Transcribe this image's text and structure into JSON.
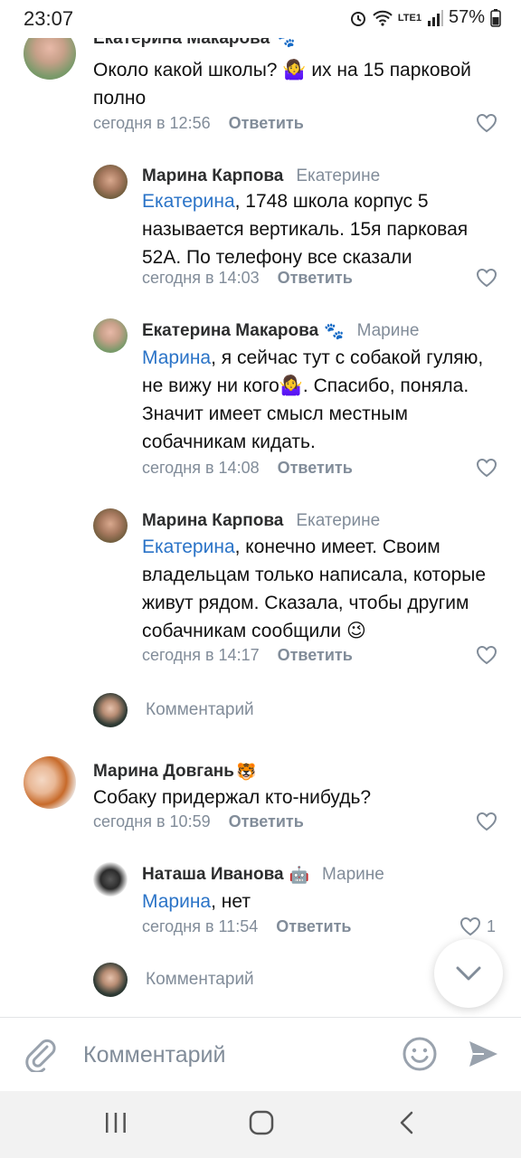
{
  "status_bar": {
    "time": "23:07",
    "battery": "57%",
    "network": "LTE1"
  },
  "comments": [
    {
      "author": "Екатерина Макарова",
      "emoji": "🐾",
      "text_parts": [
        "Около какой школы? ",
        "🤷‍♀️",
        " их на 15 парковой полно"
      ],
      "time": "сегодня в 12:56",
      "reply": "Ответить"
    },
    {
      "author": "Марина Карпова",
      "reply_to": "Екатерине",
      "mention": "Екатерина",
      "text": ", 1748 школа корпус 5 называется вертикаль. 15я парковая 52А. По телефону все сказали",
      "time": "сегодня в 14:03",
      "reply": "Ответить"
    },
    {
      "author": "Екатерина Макарова",
      "emoji": "🐾",
      "reply_to": "Марине",
      "mention": "Марина",
      "text": ", я сейчас тут с собакой гуляю, не вижу ни кого🤷‍♀️. Спасибо, поняла. Значит имеет смысл местным собачникам кидать.",
      "time": "сегодня в 14:08",
      "reply": "Ответить"
    },
    {
      "author": "Марина Карпова",
      "reply_to": "Екатерине",
      "mention": "Екатерина",
      "text": ", конечно имеет. Своим владельцам только написала, которые живут рядом. Сказала, чтобы другим собачникам сообщили 😉",
      "time": "сегодня в 14:17",
      "reply": "Ответить"
    },
    {
      "author": "Марина Довгань",
      "emoji": "🐯",
      "text": "Собаку придержал кто-нибудь?",
      "time": "сегодня в 10:59",
      "reply": "Ответить"
    },
    {
      "author": "Наташа Иванова",
      "emoji": "🤖",
      "reply_to": "Марине",
      "mention": "Марина",
      "text": ", нет",
      "time": "сегодня в 11:54",
      "reply": "Ответить",
      "likes": "1"
    }
  ],
  "add_comment_label": "Комментарий",
  "composer": {
    "placeholder": "Комментарий"
  },
  "icons": {
    "attach": "paperclip-icon",
    "smile": "smile-icon",
    "send": "send-icon",
    "like": "heart-icon",
    "scroll": "chevron-down-icon"
  },
  "colors": {
    "accent": "#2a73c7",
    "secondary": "#818c99"
  }
}
